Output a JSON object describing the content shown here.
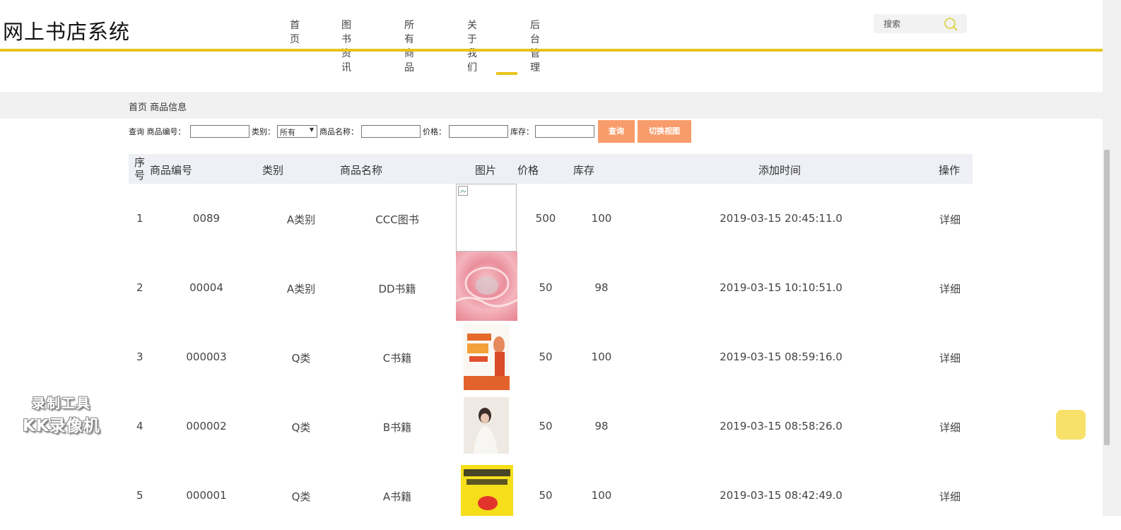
{
  "header": {
    "logo": "网上书店系统",
    "nav": [
      "首页",
      "图书资讯",
      "所有商品",
      "关于我们",
      "后台管理"
    ],
    "search_placeholder": "搜索"
  },
  "breadcrumb": "首页 商品信息",
  "filter": {
    "query_label": "查询 商品编号：",
    "category_label": "类别：",
    "category_selected": "所有",
    "name_label": "商品名称：",
    "price_label": "价格：",
    "stock_label": "库存：",
    "search_button": "查询",
    "switch_button": "切换视图"
  },
  "table": {
    "columns": [
      "序号",
      "商品编号",
      "类别",
      "商品名称",
      "图片",
      "价格",
      "库存",
      "添加时间",
      "操作"
    ],
    "rows": [
      {
        "seq": "1",
        "code": "0089",
        "category": "A类别",
        "name": "CCC图书",
        "price": "500",
        "stock": "100",
        "time": "2019-03-15 20:45:11.0",
        "action": "详细"
      },
      {
        "seq": "2",
        "code": "00004",
        "category": "A类别",
        "name": "DD书籍",
        "price": "50",
        "stock": "98",
        "time": "2019-03-15 10:10:51.0",
        "action": "详细"
      },
      {
        "seq": "3",
        "code": "000003",
        "category": "Q类",
        "name": "C书籍",
        "price": "50",
        "stock": "100",
        "time": "2019-03-15 08:59:16.0",
        "action": "详细"
      },
      {
        "seq": "4",
        "code": "000002",
        "category": "Q类",
        "name": "B书籍",
        "price": "50",
        "stock": "98",
        "time": "2019-03-15 08:58:26.0",
        "action": "详细"
      },
      {
        "seq": "5",
        "code": "000001",
        "category": "Q类",
        "name": "A书籍",
        "price": "50",
        "stock": "100",
        "time": "2019-03-15 08:42:49.0",
        "action": "详细"
      }
    ]
  },
  "watermark": {
    "line1": "录制工具",
    "line2": "KK录像机"
  },
  "colors": {
    "accent_yellow": "#e8c31b",
    "button_orange": "#f99c6b",
    "header_bg": "#eef0f6"
  }
}
